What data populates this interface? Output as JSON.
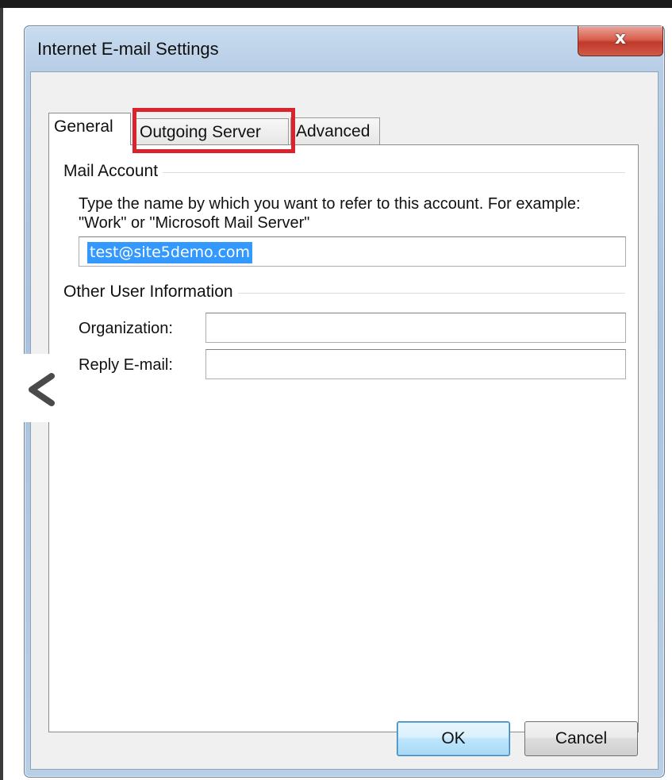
{
  "window": {
    "title": "Internet E-mail Settings",
    "close_symbol": "x"
  },
  "tabs": [
    {
      "label": "General",
      "selected": true
    },
    {
      "label": "Outgoing Server",
      "selected": false,
      "highlighted": true
    },
    {
      "label": "Advanced",
      "selected": false
    }
  ],
  "highlight_color": "#d9232d",
  "mail_account": {
    "group_title": "Mail Account",
    "description": "Type the name by which you want to refer to this account. For example: \"Work\" or \"Microsoft Mail Server\"",
    "account_name_value": "test@site5demo.com"
  },
  "other_user_information": {
    "group_title": "Other User Information",
    "organization_label": "Organization:",
    "organization_value": "",
    "reply_email_label": "Reply E-mail:",
    "reply_email_value": ""
  },
  "buttons": {
    "ok_label": "OK",
    "cancel_label": "Cancel"
  },
  "overlay": {
    "prev_icon": "chevron-left-icon"
  }
}
